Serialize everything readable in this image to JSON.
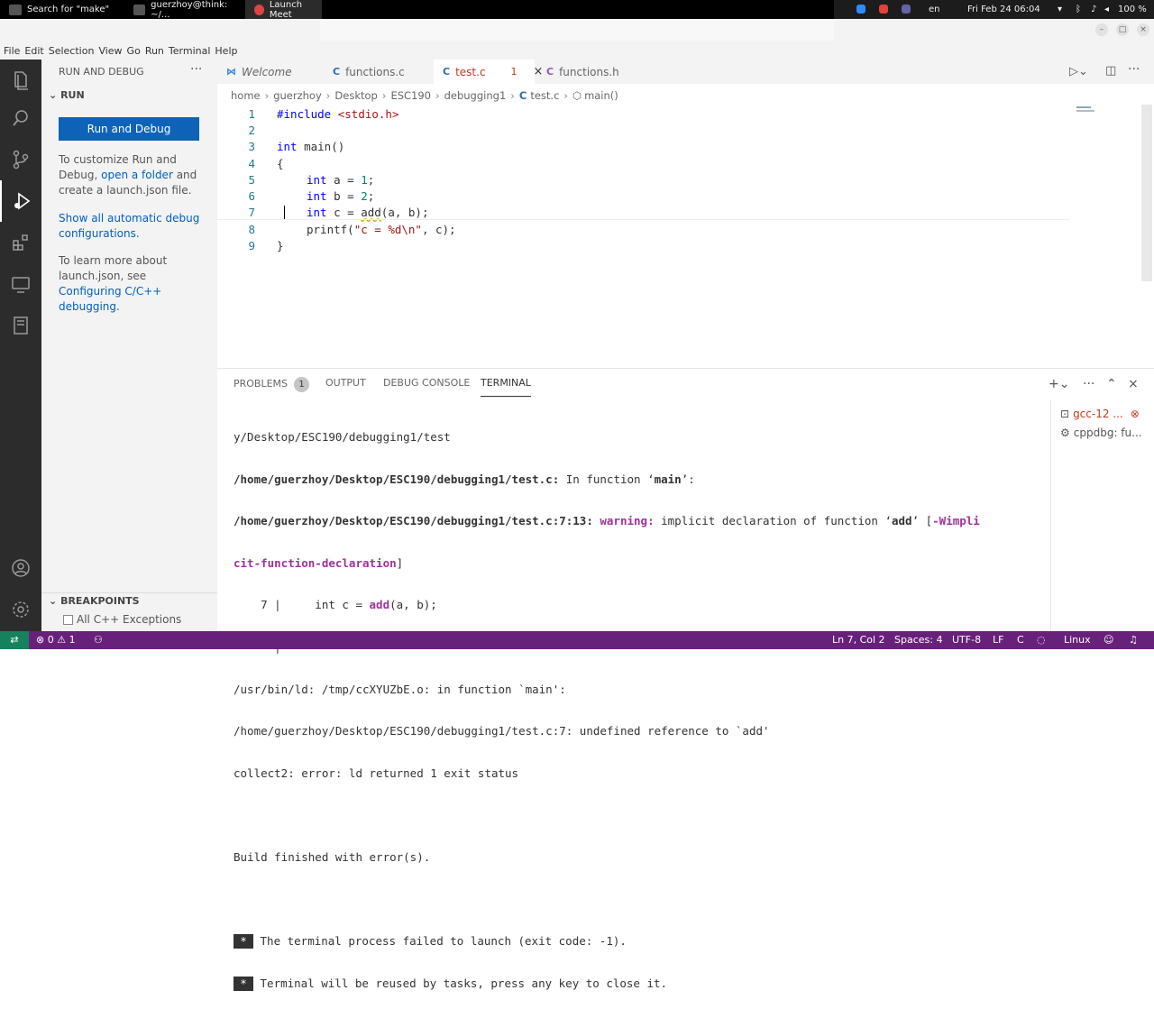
{
  "os_bar": {
    "tasks": [
      "Search for \"make\"",
      "guerzhoy@think: ~/...",
      "Launch Meet"
    ],
    "tray": {
      "lang": "en",
      "datetime": "Fri Feb 24  06:04",
      "battery": "100 %"
    }
  },
  "menu": [
    "File",
    "Edit",
    "Selection",
    "View",
    "Go",
    "Run",
    "Terminal",
    "Help"
  ],
  "sidebar": {
    "title": "RUN AND DEBUG",
    "more": "···",
    "section": "RUN",
    "run_button": "Run and Debug",
    "p1_a": "To customize Run and",
    "p1_b": "Debug,",
    "p1_link": "open a folder",
    "p1_c": "and",
    "p1_d": "create a launch.json file.",
    "p2_link_a": "Show all automatic debug",
    "p2_link_b": "configurations.",
    "p3_a": "To learn more about",
    "p3_b": "launch.json, see",
    "p3_link_a": "Configuring C/C++",
    "p3_link_b": "debugging.",
    "breakpoints": "BREAKPOINTS",
    "bp_item": "All C++ Exceptions"
  },
  "tabs": [
    {
      "label": "Welcome",
      "icon": "vscode-icon"
    },
    {
      "label": "functions.c",
      "icon": "C"
    },
    {
      "label": "test.c",
      "icon": "C",
      "problems": "1",
      "close": "×"
    },
    {
      "label": "functions.h",
      "icon": "C"
    }
  ],
  "breadcrumb": [
    "home",
    "guerzhoy",
    "Desktop",
    "ESC190",
    "debugging1",
    "test.c",
    "main()"
  ],
  "code": {
    "line_numbers": [
      "1",
      "2",
      "3",
      "4",
      "5",
      "6",
      "7",
      "8",
      "9"
    ],
    "l1_kw": "#include",
    "l1_str": "<stdio.h>",
    "l3_kw": "int",
    "l3_rest": " main()",
    "l4": "{",
    "l5_kw": "int",
    "l5_a": " a = ",
    "l5_n": "1",
    "l5_e": ";",
    "l6_kw": "int",
    "l6_a": " b = ",
    "l6_n": "2",
    "l6_e": ";",
    "l7_kw": "int",
    "l7_a": " c = ",
    "l7_fn": "add",
    "l7_e": "(a, b);",
    "l8_a": "printf(",
    "l8_str": "\"c = %d\\n\"",
    "l8_e": ", c);",
    "l9": "}"
  },
  "panel": {
    "tabs": [
      "PROBLEMS",
      "OUTPUT",
      "DEBUG CONSOLE",
      "TERMINAL"
    ],
    "problems_count": "1",
    "terminal": {
      "l1": "y/Desktop/ESC190/debugging1/test",
      "l2_b": "/home/guerzhoy/Desktop/ESC190/debugging1/test.c:",
      "l2_r": " In function ‘",
      "l2_fn": "main",
      "l2_e": "’:",
      "l3_b": "/home/guerzhoy/Desktop/ESC190/debugging1/test.c:7:13:",
      "l3_w": " warning:",
      "l3_r": " implicit declaration of function ‘",
      "l3_fn": "add",
      "l3_e": "’ [",
      "l3_flag": "-Wimpli",
      "l4_flag": "cit-function-declaration",
      "l4_e": "]",
      "l5_a": "    7 |     int c = ",
      "l5_fn": "add",
      "l5_e": "(a, b);",
      "l6_a": "      |             ",
      "l6_m": "^~~",
      "l7": "/usr/bin/ld: /tmp/ccXYUZbE.o: in function `main':",
      "l8": "/home/guerzhoy/Desktop/ESC190/debugging1/test.c:7: undefined reference to `add'",
      "l9": "collect2: error: ld returned 1 exit status",
      "l11": "Build finished with error(s).",
      "star": "*",
      "l13": " The terminal process failed to launch (exit code: -1).",
      "l14": " Terminal will be reused by tasks, press any key to close it."
    },
    "term_list": [
      "gcc-12 ...",
      "cppdbg: fu..."
    ]
  },
  "status": {
    "errors": "0",
    "warnings": "1",
    "position": "Ln 7, Col 2",
    "spaces": "Spaces: 4",
    "encoding": "UTF-8",
    "eol": "LF",
    "lang": "C",
    "os": "Linux"
  },
  "colors": {
    "status_bar": "#68217a",
    "activity_bar": "#2c2c2c",
    "run_button": "#0e63b8"
  }
}
